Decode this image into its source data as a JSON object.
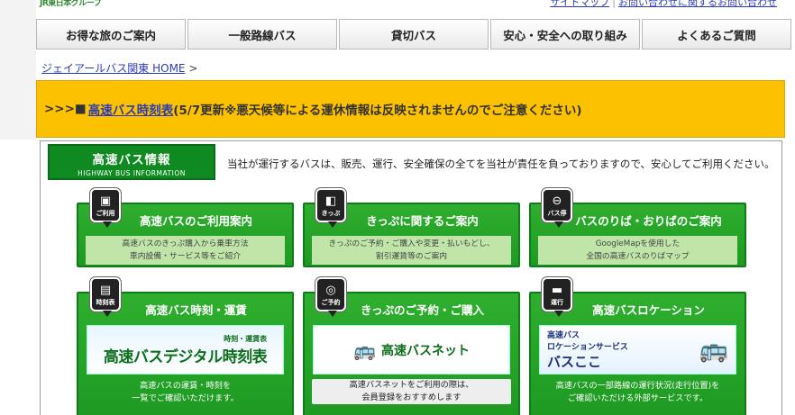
{
  "header": {
    "logo_text": "JR東日本グループ",
    "links": [
      "サイトマップ",
      "お問い合わせに関するお問い合わせ"
    ]
  },
  "nav": [
    "お得な旅のご案内",
    "一般路線バス",
    "貸切バス",
    "安心・安全への取り組み",
    "よくあるご質問"
  ],
  "breadcrumb": {
    "home": "ジェイアールバス関東 HOME",
    "sep": ">"
  },
  "notice": {
    "prefix": ">>>■",
    "link": "高速バス時刻表",
    "text": "(5/7更新※悪天候等による運休情報は反映されませんのでご注意ください)"
  },
  "section": {
    "title": "高速バス情報",
    "subtitle": "HIGHWAY BUS INFORMATION",
    "intro": "当社が運行するバスは、販売、運行、安全確保の全てを当社が責任を負っておりますので、安心してご利用ください。"
  },
  "cards": [
    {
      "badge": "ご利用",
      "icon": "bus-icon",
      "title": "高速バスのご利用案内",
      "desc1": "高速バスのきっぷ購入から乗車方法",
      "desc2": "車内設備・サービス等をご紹介"
    },
    {
      "badge": "きっぷ",
      "icon": "ticket-icon",
      "title": "きっぷに関するご案内",
      "desc1": "きっぷのご予約・ご購入や変更・払いもどし、",
      "desc2": "割引運賃等のご案内"
    },
    {
      "badge": "バス停",
      "icon": "bus-stop-icon",
      "title": "バスのりば・おりばのご案内",
      "desc1": "GoogleMapを使用した",
      "desc2": "全国の高速バスのりばマップ"
    },
    {
      "badge": "時刻表",
      "icon": "timetable-icon",
      "title": "高速バス時刻・運賃",
      "banner_small": "時刻・運賃表",
      "banner_big": "高速バスデジタル時刻表",
      "foot1": "高速バスの運賃・時刻を",
      "foot2": "一覧でご確認いただけます。"
    },
    {
      "badge": "ご予約",
      "icon": "reservation-icon",
      "title": "きっぷのご予約・ご購入",
      "banner_big": "高速バスネット",
      "foot1": "高速バスネットをご利用の際は、",
      "foot2": "会員登録をおすすめします"
    },
    {
      "badge": "運行",
      "icon": "location-icon",
      "title": "高速バスロケーション",
      "banner_small": "高速バス",
      "banner_small2": "ロケーションサービス",
      "banner_big": "バスここ",
      "foot1": "高速バスの一部路線の運行状況(走行位置)を",
      "foot2": "ご確認いただける外部サービスです。"
    }
  ],
  "colors": {
    "green": "#1e9a22",
    "notice": "#fcc100",
    "link": "#2b3bb5"
  }
}
